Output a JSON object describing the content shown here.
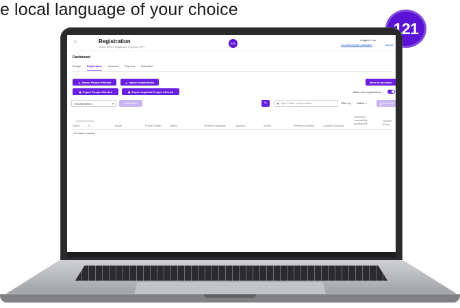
{
  "tagline": "e local language of your choice",
  "logo_text": "121",
  "app": {
    "title": "Registration",
    "subtitle": "NLRC DREF Digital Aid Program (RP)",
    "header_badge": "121",
    "logged_in_label": "Logged in as:",
    "user_email": "121-admin@user-example.nl",
    "logout_label": "Log out"
  },
  "dashboard_title": "Dashboard",
  "tabs": [
    {
      "label": "Design",
      "active": false
    },
    {
      "label": "Registration",
      "active": true
    },
    {
      "label": "Inclusion",
      "active": false
    },
    {
      "label": "Payment",
      "active": false
    },
    {
      "label": "Evaluation",
      "active": false
    }
  ],
  "actions": {
    "import_people": "Import People Affected",
    "import_registrations": "Import registrations",
    "export_people": "Export People Affected",
    "export_duplicates": "Export duplicate People Affected",
    "move_inclusion": "Move to inclusion",
    "allow_new_registrations": "Allow new registrations",
    "allow_new_registrations_on": true,
    "choose_action": "Choose action...",
    "apply_action": "Apply action",
    "filter_placeholder": "Type to filter in any column...",
    "filter_by_label": "Filter by:",
    "status_select": "Status",
    "export_list": "Export list"
  },
  "table": {
    "select_all_label": "Select all entries",
    "columns": [
      "Select",
      "Id",
      "Name",
      "Phone number",
      "Status",
      "Preferred language",
      "Imported",
      "Invited",
      "Reference number",
      "Created (Optional)",
      "Document vulnerability assessment",
      "Transfer (Euro)"
    ],
    "empty_message": "No data to display"
  },
  "colors": {
    "accent": "#6a1ee0",
    "brand_badge": "#5b13d6",
    "disabled_button": "#c8b5f2"
  },
  "icons": {
    "home": "home-icon",
    "upload": "upload-icon",
    "download": "download-icon",
    "refresh": "refresh-icon",
    "filter": "filter-icon"
  }
}
